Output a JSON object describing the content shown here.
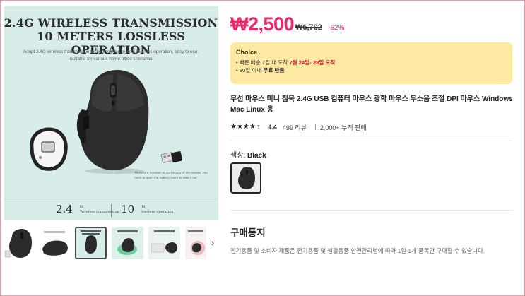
{
  "product_image": {
    "headline_1": "2.4G WIRELESS TRANSMISSION",
    "headline_2": "10 METERS LOSSLESS OPERATION",
    "description": "Adopt 2.4G wireless transmission technology, ten meters lossless operation, easy to use. Suitable for various home office scenarios",
    "receiver_note": "There is a receiver at the bottom of the mouse, you need to open the battery cover to take it out",
    "spec_1_value": "2.4",
    "spec_1_unit": "G",
    "spec_1_caption": "Wireless transmission",
    "spec_2_value": "10",
    "spec_2_unit": "M",
    "spec_2_caption": "lossless operation",
    "background_color": "#d8ecea"
  },
  "thumbnails": {
    "count": 7,
    "selected_index": 2,
    "next_icon": "chevron-right-icon",
    "next_glyph": "›"
  },
  "price": {
    "current": "₩2,500",
    "original": "₩6,702",
    "discount": "-62%",
    "accent_color": "#f0266a"
  },
  "choice": {
    "title": "Choice",
    "delivery_prefix": "• 빠른 배송 7일 내 도착 ",
    "delivery_dates": "7월 24일- 28일 도착",
    "returns_prefix": "• 90일 이내 ",
    "returns_bold": "무료 반품",
    "background_color": "#fde9a1"
  },
  "product": {
    "title": "무선 마우스 미니 침묵 2.4G USB 컴퓨터 마우스 광학 마우스 무소음 조절 DPI 마우스 Windows Mac Linux 용"
  },
  "rating": {
    "stars": "★★★★",
    "star_count_label": "1",
    "score": "4.4",
    "reviews": "499 리뷰",
    "sales": "2,000+ 누적 판매"
  },
  "color_option": {
    "label": "색상: ",
    "value": "Black"
  },
  "notice": {
    "title": "구매통지",
    "body": "전기용품 및 소비자 제품은 전기용품 및 생활용품 안전관리법에 따라 1일 1개 품목만 구매할 수 있습니다."
  }
}
